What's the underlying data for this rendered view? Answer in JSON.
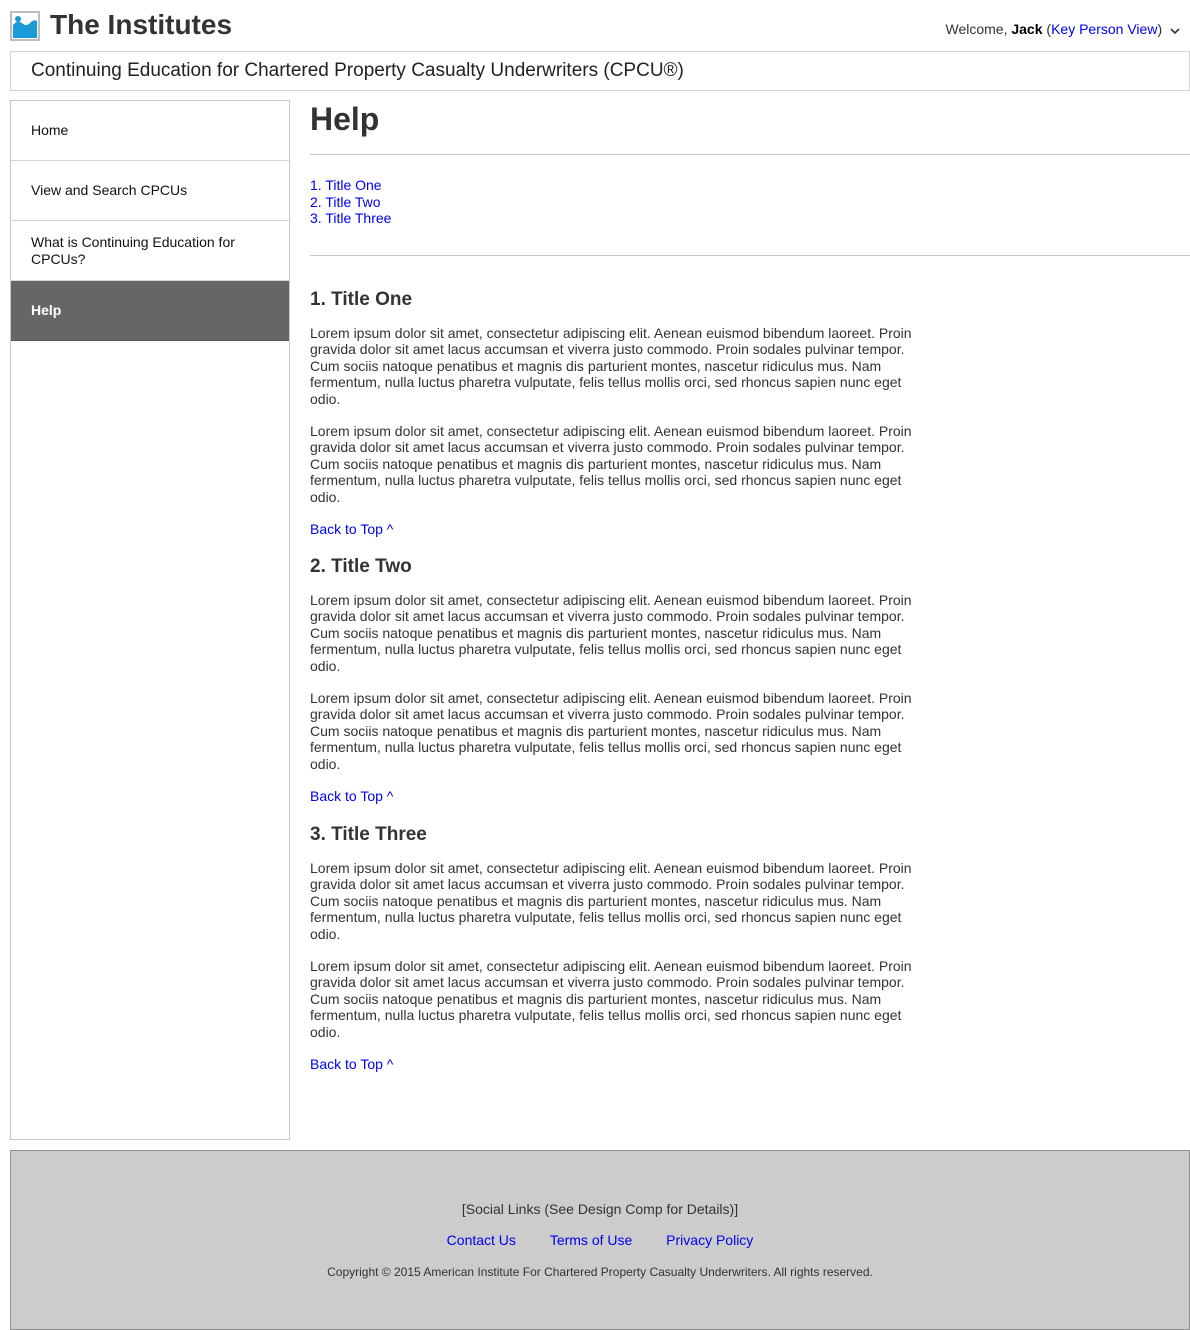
{
  "header": {
    "brand": "The Institutes",
    "logo_icon": "image-placeholder-icon",
    "welcome_prefix": "Welcome, ",
    "user_name": "Jack",
    "open_paren": " (",
    "view_link": "Key Person View",
    "close_paren": ")",
    "dropdown_icon": "chevron-down-icon"
  },
  "subtitle": "Continuing Education for Chartered Property Casualty Underwriters (CPCU®)",
  "sidebar": {
    "items": [
      {
        "label": "Home",
        "active": false
      },
      {
        "label": "View and Search CPCUs",
        "active": false
      },
      {
        "label": "What is Continuing Education for CPCUs?",
        "active": false
      },
      {
        "label": "Help",
        "active": true
      }
    ]
  },
  "main": {
    "title": "Help",
    "toc": [
      "1. Title One",
      "2. Title Two",
      "3. Title Three"
    ],
    "sections": [
      {
        "heading": "1. Title One",
        "paragraphs": [
          "Lorem ipsum dolor sit amet, consectetur adipiscing elit. Aenean euismod bibendum laoreet. Proin gravida dolor sit amet lacus accumsan et viverra justo commodo. Proin sodales pulvinar tempor. Cum sociis natoque penatibus et magnis dis parturient montes, nascetur ridiculus mus. Nam fermentum, nulla luctus pharetra vulputate, felis tellus mollis orci, sed rhoncus sapien nunc eget odio.",
          "Lorem ipsum dolor sit amet, consectetur adipiscing elit. Aenean euismod bibendum laoreet. Proin gravida dolor sit amet lacus accumsan et viverra justo commodo. Proin sodales pulvinar tempor. Cum sociis natoque penatibus et magnis dis parturient montes, nascetur ridiculus mus. Nam fermentum, nulla luctus pharetra vulputate, felis tellus mollis orci, sed rhoncus sapien nunc eget odio."
        ],
        "back_to_top": "Back to Top ^"
      },
      {
        "heading": "2. Title Two",
        "paragraphs": [
          "Lorem ipsum dolor sit amet, consectetur adipiscing elit. Aenean euismod bibendum laoreet. Proin gravida dolor sit amet lacus accumsan et viverra justo commodo. Proin sodales pulvinar tempor. Cum sociis natoque penatibus et magnis dis parturient montes, nascetur ridiculus mus. Nam fermentum, nulla luctus pharetra vulputate, felis tellus mollis orci, sed rhoncus sapien nunc eget odio.",
          "Lorem ipsum dolor sit amet, consectetur adipiscing elit. Aenean euismod bibendum laoreet. Proin gravida dolor sit amet lacus accumsan et viverra justo commodo. Proin sodales pulvinar tempor. Cum sociis natoque penatibus et magnis dis parturient montes, nascetur ridiculus mus. Nam fermentum, nulla luctus pharetra vulputate, felis tellus mollis orci, sed rhoncus sapien nunc eget odio."
        ],
        "back_to_top": "Back to Top ^"
      },
      {
        "heading": "3. Title Three",
        "paragraphs": [
          "Lorem ipsum dolor sit amet, consectetur adipiscing elit. Aenean euismod bibendum laoreet. Proin gravida dolor sit amet lacus accumsan et viverra justo commodo. Proin sodales pulvinar tempor. Cum sociis natoque penatibus et magnis dis parturient montes, nascetur ridiculus mus. Nam fermentum, nulla luctus pharetra vulputate, felis tellus mollis orci, sed rhoncus sapien nunc eget odio.",
          "Lorem ipsum dolor sit amet, consectetur adipiscing elit. Aenean euismod bibendum laoreet. Proin gravida dolor sit amet lacus accumsan et viverra justo commodo. Proin sodales pulvinar tempor. Cum sociis natoque penatibus et magnis dis parturient montes, nascetur ridiculus mus. Nam fermentum, nulla luctus pharetra vulputate, felis tellus mollis orci, sed rhoncus sapien nunc eget odio."
        ],
        "back_to_top": "Back to Top ^"
      }
    ]
  },
  "footer": {
    "social_placeholder": "[Social Links (See Design Comp for Details)]",
    "links": [
      "Contact Us",
      "Terms of Use",
      "Privacy Policy"
    ],
    "copyright": "Copyright © 2015 American Institute For Chartered Property Casualty Underwriters. All rights reserved."
  },
  "colors": {
    "link": "#0000ee",
    "active_nav_bg": "#666666",
    "footer_bg": "#cccccc",
    "logo_blue": "#1a9ad6",
    "text": "#333333"
  }
}
